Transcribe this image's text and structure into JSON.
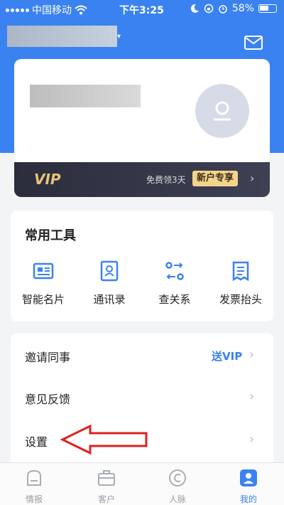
{
  "status_bar": {
    "carrier": "中国移动",
    "time": "下午3:25",
    "battery": "58%"
  },
  "vip": {
    "label": "VIP",
    "free_text": "免费领3天",
    "badge": "新户专享",
    "arrow": "›"
  },
  "tools": {
    "title": "常用工具",
    "items": [
      {
        "label": "智能名片",
        "icon": "business-card-icon"
      },
      {
        "label": "通讯录",
        "icon": "contacts-icon"
      },
      {
        "label": "查关系",
        "icon": "relationship-icon"
      },
      {
        "label": "发票抬头",
        "icon": "invoice-icon"
      }
    ]
  },
  "menu": {
    "items": [
      {
        "label": "邀请同事",
        "extra": "送VIP"
      },
      {
        "label": "意见反馈",
        "extra": ""
      },
      {
        "label": "设置",
        "extra": ""
      }
    ],
    "chevron": "›"
  },
  "tabs": [
    {
      "label": "情报",
      "icon": "news-icon",
      "active": false
    },
    {
      "label": "客户",
      "icon": "briefcase-icon",
      "active": false
    },
    {
      "label": "人脉",
      "icon": "network-icon",
      "active": false
    },
    {
      "label": "我的",
      "icon": "profile-icon",
      "active": true
    }
  ],
  "colors": {
    "primary": "#3a82f0",
    "vip_gold": "#e5c47a",
    "annotation": "#e02020"
  }
}
